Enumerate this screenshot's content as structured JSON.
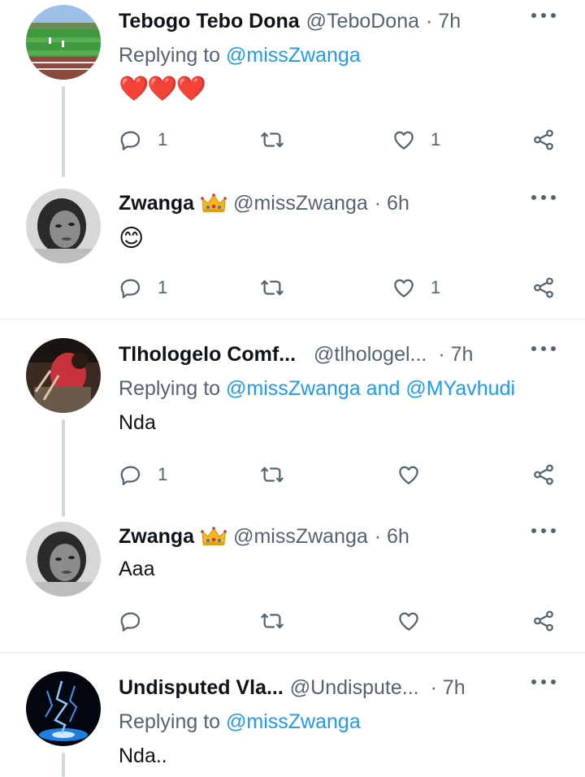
{
  "tweets": [
    {
      "name": "Tebogo Tebo Dona",
      "handle": "@TeboDona",
      "time": "· 7h",
      "replying_prefix": "Replying to ",
      "replying_to": "@missZwanga",
      "content": "❤️❤️❤️",
      "replies": "1",
      "retweets": "",
      "likes": "1",
      "avatar": "stadium-photo"
    },
    {
      "name": "Zwanga",
      "handle": "@missZwanga",
      "time": "· 6h",
      "badge": "crown-emoji",
      "content": "😊",
      "replies": "1",
      "retweets": "",
      "likes": "1",
      "avatar": "bw-portrait"
    },
    {
      "name": "Tlhologelo Comf...",
      "handle": "@tlhologel...",
      "time": "· 7h",
      "replying_prefix": "Replying to ",
      "replying_to": "@missZwanga",
      "replying_and": " and ",
      "replying_to2": "@MYavhudi",
      "content": "Nda",
      "replies": "1",
      "retweets": "",
      "likes": "",
      "avatar": "red-outfit-photo"
    },
    {
      "name": "Zwanga",
      "handle": "@missZwanga",
      "time": "· 6h",
      "badge": "crown-emoji",
      "content": "Aaa",
      "replies": "",
      "retweets": "",
      "likes": "",
      "avatar": "bw-portrait"
    },
    {
      "name": "Undisputed Vla...",
      "handle": "@Undispute...",
      "time": "· 7h",
      "replying_prefix": "Replying to ",
      "replying_to": "@missZwanga",
      "content": "Nda..",
      "avatar": "blue-lightning"
    }
  ],
  "colors": {
    "accent": "#1d9bf0",
    "secondary_text": "#536471",
    "thread_line": "#cfd9de",
    "heart": "#f91880"
  }
}
